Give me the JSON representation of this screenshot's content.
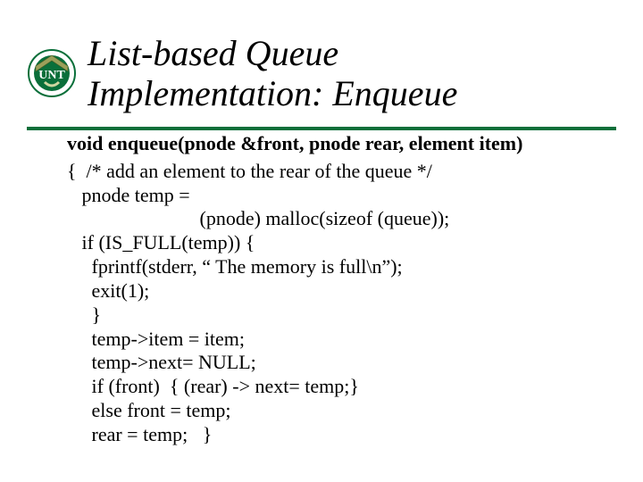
{
  "title_line1": "List-based Queue",
  "title_line2": "Implementation: Enqueue",
  "signature": "void enqueue(pnode &front, pnode rear, element item)",
  "code": {
    "l0": "{  /* add an element to the rear of the queue */",
    "l1": "   pnode temp =",
    "l2": "                           (pnode) malloc(sizeof (queue));",
    "l3": "   if (IS_FULL(temp)) {",
    "l4": "     fprintf(stderr, “ The memory is full\\n”);",
    "l5": "     exit(1);",
    "l6": "     }",
    "l7": "     temp->item = item;",
    "l8": "     temp->next= NULL;",
    "l9": "     if (front)  { (rear) -> next= temp;}",
    "l10": "     else front = temp;",
    "l11": "     rear = temp;   }"
  },
  "logo_alt": "UNT University of North Texas logo"
}
